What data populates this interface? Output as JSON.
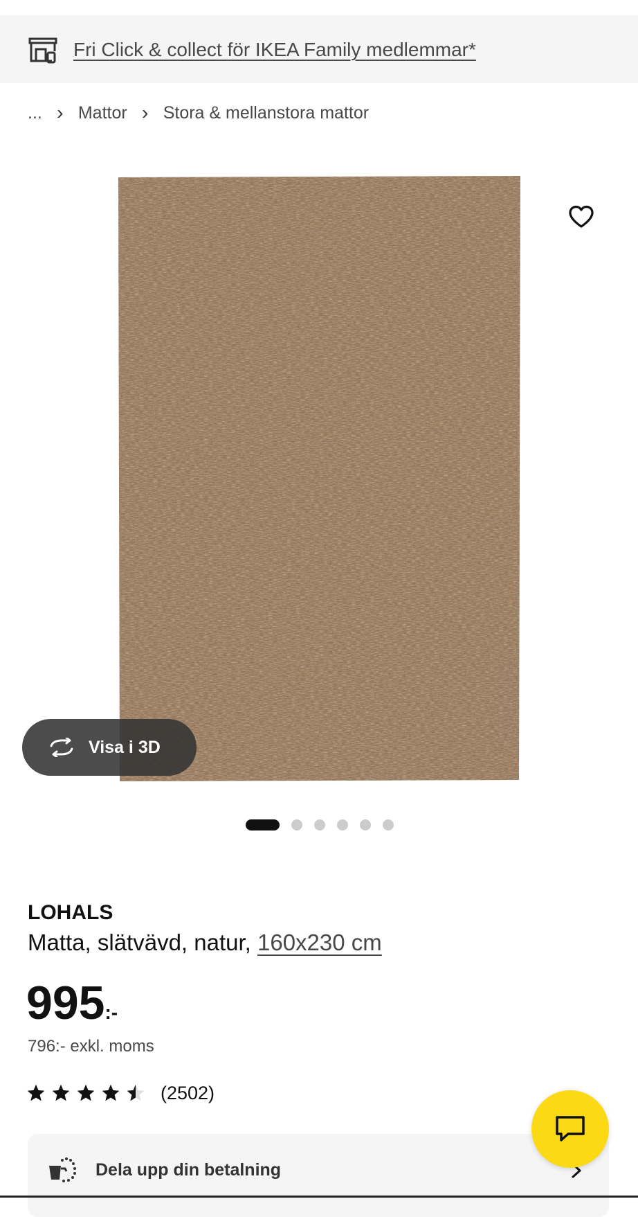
{
  "banner": {
    "link_text": "Fri Click & collect för IKEA Family medlemmar*",
    "icon": "store-pickup-icon"
  },
  "breadcrumb": {
    "items": [
      "...",
      "Mattor",
      "Stora & mellanstora mattor"
    ],
    "separator": "›"
  },
  "gallery": {
    "image": "jute-rug-product-image",
    "view_3d_label": "Visa i 3D",
    "dot_count": 6,
    "active_dot": 0,
    "favorite_icon": "heart-icon"
  },
  "product": {
    "name": "LOHALS",
    "description": "Matta, slätvävd, natur, ",
    "size_link": "160x230 cm",
    "price_amount": "995",
    "price_suffix": ":-",
    "price_ex_vat": "796:- exkl. moms",
    "rating_value": 4.5,
    "rating_max": 5,
    "review_count": "(2502)"
  },
  "payment": {
    "label": "Dela upp din betalning",
    "icon": "split-payment-icon"
  },
  "chat": {
    "icon": "chat-bubble-icon"
  },
  "colors": {
    "brand_yellow": "#fbd914",
    "banner_bg": "#f5f5f5",
    "rug_brown": "#9b7b5e"
  }
}
